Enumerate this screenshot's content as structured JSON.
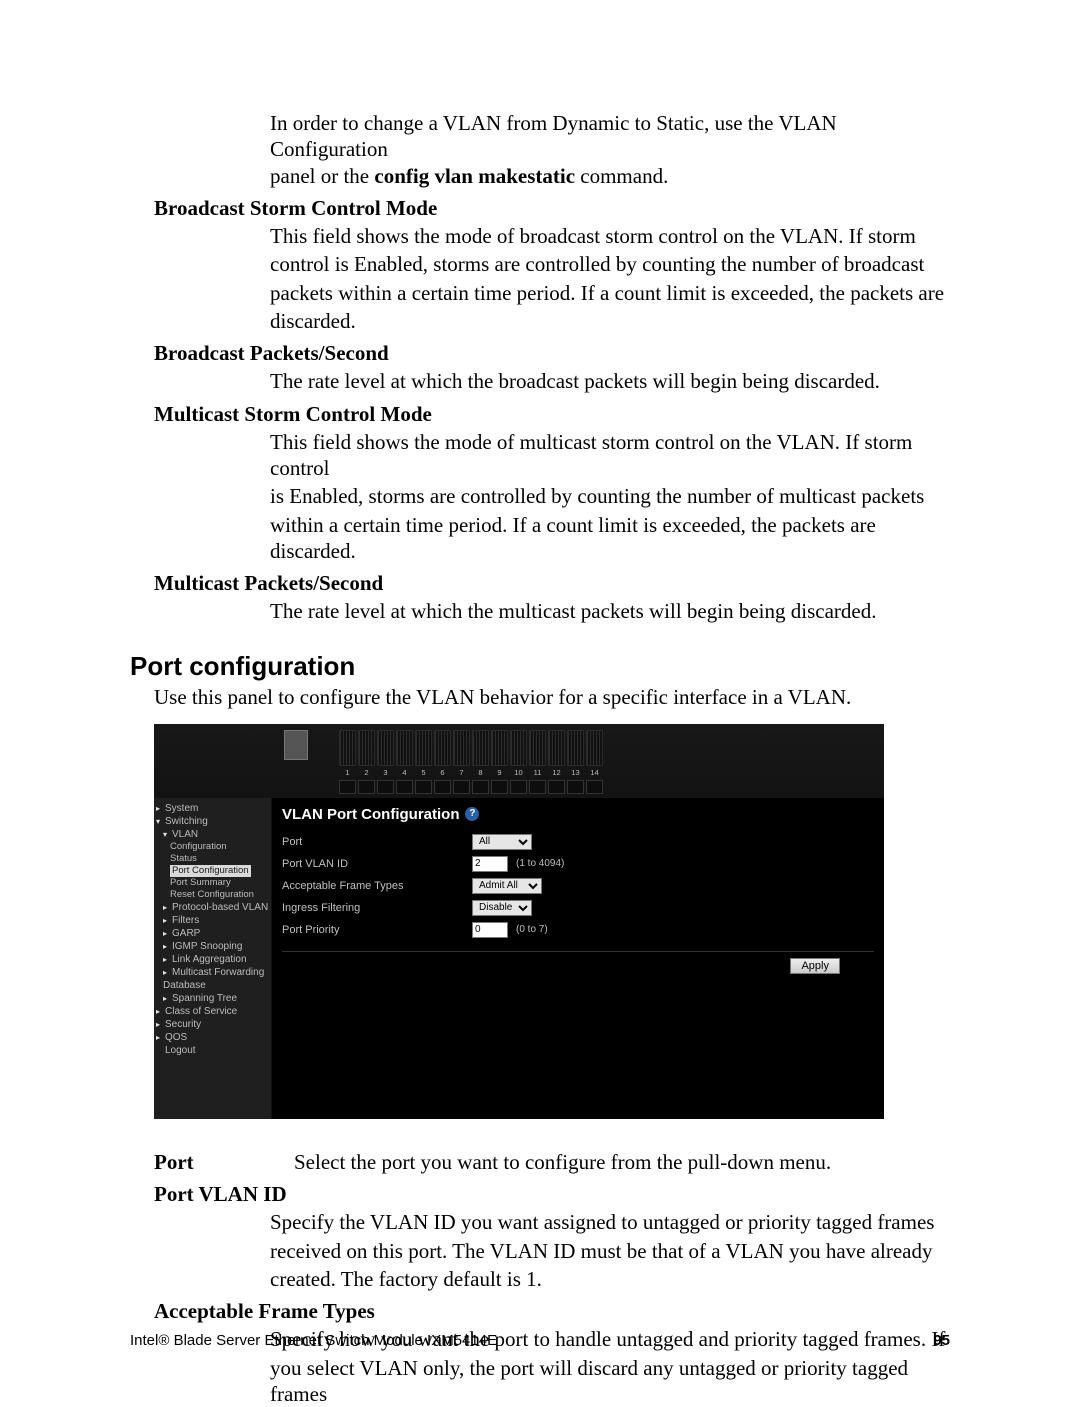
{
  "intro": {
    "line1": "In order to change a VLAN from Dynamic to Static, use the VLAN Configuration",
    "line2_a": "panel or the ",
    "line2_cmd": "config vlan makestatic",
    "line2_b": " command."
  },
  "defs": [
    {
      "term": "Broadcast Storm Control Mode",
      "body": [
        "This field shows the mode of broadcast storm control on the VLAN. If storm",
        "control is Enabled, storms are controlled by counting the number of broadcast",
        "packets within a certain time period. If a count limit is exceeded, the packets are",
        "discarded."
      ]
    },
    {
      "term": "Broadcast Packets/Second",
      "body": [
        "The rate level at which the broadcast packets will begin being discarded."
      ]
    },
    {
      "term": "Multicast Storm Control Mode",
      "body": [
        "This field shows the mode of multicast storm control on the VLAN. If storm control",
        "is Enabled, storms are controlled by counting the number of multicast packets",
        "within a certain time period. If a count limit is exceeded, the packets are discarded."
      ]
    },
    {
      "term": "Multicast Packets/Second",
      "body": [
        "The rate level at which the multicast packets will begin being discarded."
      ]
    }
  ],
  "section": {
    "heading": "Port configuration",
    "intro": "Use this panel to configure the VLAN behavior for a specific interface in a VLAN."
  },
  "ui": {
    "ruler_numbers": [
      "1",
      "2",
      "3",
      "4",
      "5",
      "6",
      "7",
      "8",
      "9",
      "10",
      "11",
      "12",
      "13",
      "14"
    ],
    "sidebar": [
      {
        "cls": "lvl0 caret",
        "text": "System"
      },
      {
        "cls": "lvl0 caret-d",
        "text": "Switching"
      },
      {
        "cls": "lvl1 caret-d",
        "text": "VLAN"
      },
      {
        "cls": "lvl2",
        "text": "Configuration"
      },
      {
        "cls": "lvl2",
        "text": "Status"
      },
      {
        "cls": "lvl2 sel",
        "text": "Port Configuration"
      },
      {
        "cls": "lvl2",
        "text": "Port Summary"
      },
      {
        "cls": "lvl2",
        "text": "Reset Configuration"
      },
      {
        "cls": "lvl1 caret",
        "text": "Protocol-based VLAN"
      },
      {
        "cls": "lvl1 caret",
        "text": "Filters"
      },
      {
        "cls": "lvl1 caret",
        "text": "GARP"
      },
      {
        "cls": "lvl1 caret",
        "text": "IGMP Snooping"
      },
      {
        "cls": "lvl1 caret",
        "text": "Link Aggregation"
      },
      {
        "cls": "lvl1 caret",
        "text": "Multicast Forwarding Database"
      },
      {
        "cls": "lvl1 caret",
        "text": "Spanning Tree"
      },
      {
        "cls": "lvl0 caret",
        "text": "Class of Service"
      },
      {
        "cls": "lvl0 caret",
        "text": "Security"
      },
      {
        "cls": "lvl0 caret",
        "text": "QOS"
      },
      {
        "cls": "lvl0",
        "text": "Logout"
      }
    ],
    "main": {
      "title": "VLAN Port Configuration",
      "help": "?",
      "fields": {
        "port_label": "Port",
        "port_value": "All",
        "pvid_label": "Port VLAN ID",
        "pvid_value": "2",
        "pvid_hint": "(1 to 4094)",
        "aft_label": "Acceptable Frame Types",
        "aft_value": "Admit All",
        "if_label": "Ingress Filtering",
        "if_value": "Disable",
        "pp_label": "Port Priority",
        "pp_value": "0",
        "pp_hint": "(0 to 7)"
      },
      "apply": "Apply"
    }
  },
  "post": {
    "port_term": "Port",
    "port_def": "Select the port you want to configure from the pull-down menu.",
    "pvid_term": "Port VLAN ID",
    "pvid_body": [
      "Specify the VLAN ID you want assigned to untagged or priority tagged frames",
      "received on this port. The VLAN ID must be that of a VLAN you have already",
      "created. The factory default is 1."
    ],
    "aft_term": "Acceptable Frame Types",
    "aft_body": [
      "Specify how you want the port to handle untagged and priority tagged frames. If",
      "you select VLAN only, the port will discard any untagged or priority tagged frames"
    ]
  },
  "footer": {
    "left": "Intel® Blade Server Ethernet Switch Module IXM5414E",
    "right": "95"
  }
}
